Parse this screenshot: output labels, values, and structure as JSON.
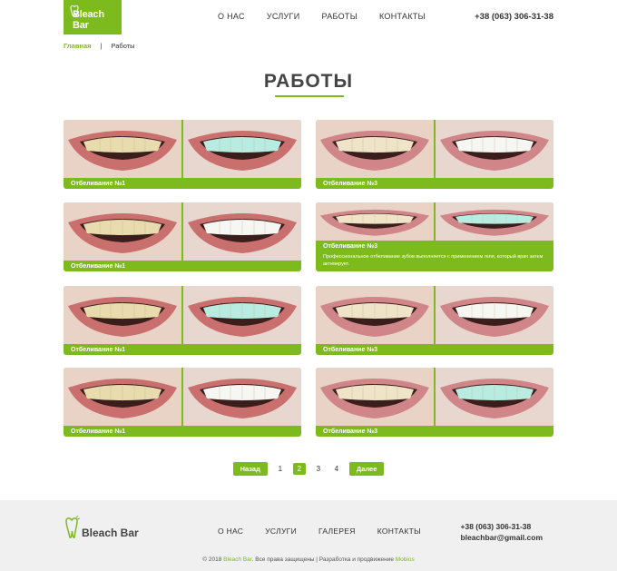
{
  "header": {
    "logo_text": "Bleach Bar",
    "nav": [
      "О НАС",
      "УСЛУГИ",
      "РАБОТЫ",
      "КОНТАКТЫ"
    ],
    "phone": "+38 (063) 306-31-38"
  },
  "breadcrumb": {
    "home": "Главная",
    "separator": "|",
    "current": "Работы"
  },
  "page_title": "РАБОТЫ",
  "cards": [
    {
      "label": "Отбеливание №1",
      "description": ""
    },
    {
      "label": "Отбеливание №3",
      "description": ""
    },
    {
      "label": "Отбеливание №1",
      "description": ""
    },
    {
      "label": "Отбеливание №3",
      "description": "Профессиональное отбеливание зубов выполняется с применением геля, который врач затем активирует."
    },
    {
      "label": "Отбеливание №1",
      "description": ""
    },
    {
      "label": "Отбеливание №3",
      "description": ""
    },
    {
      "label": "Отбеливание №1",
      "description": ""
    },
    {
      "label": "Отбеливание №3",
      "description": ""
    }
  ],
  "pagination": {
    "prev": "Назад",
    "pages": [
      "1",
      "2",
      "3",
      "4"
    ],
    "active": "2",
    "next": "Далее"
  },
  "footer": {
    "logo_text": "Bleach Bar",
    "nav": [
      "О НАС",
      "УСЛУГИ",
      "ГАЛЕРЕЯ",
      "КОНТАКТЫ"
    ],
    "phone": "+38 (063) 306-31-38",
    "email": "bleachbar@gmail.com",
    "copyright_prefix": "© 2018",
    "copyright_brand": "Bleach Bar",
    "copyright_mid": ". Все права защищены | Разработка и продвижение",
    "copyright_dev": "Mobios"
  },
  "colors": {
    "accent": "#7cba1e",
    "footer_bg": "#f0f0f0"
  }
}
